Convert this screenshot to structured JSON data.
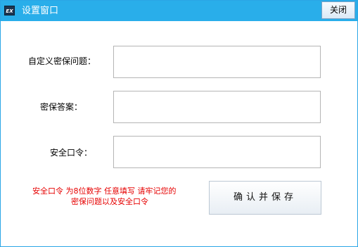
{
  "window": {
    "title": "设置窗口",
    "icon_text": "EX",
    "close_label": "关闭"
  },
  "form": {
    "question_label": "自定义密保问题：",
    "question_value": "",
    "answer_label": "密保答案：",
    "answer_value": "",
    "password_label": "安全口令：",
    "password_value": ""
  },
  "hint": {
    "line1": "安全口令  为8位数字  任意填写  请牢记您的",
    "line2": "密保问题以及安全口令"
  },
  "actions": {
    "confirm_label": "确认并保存"
  },
  "colors": {
    "titlebar": "#29aeea",
    "hint_text": "#e60000",
    "field_border": "#b5b5b5"
  }
}
